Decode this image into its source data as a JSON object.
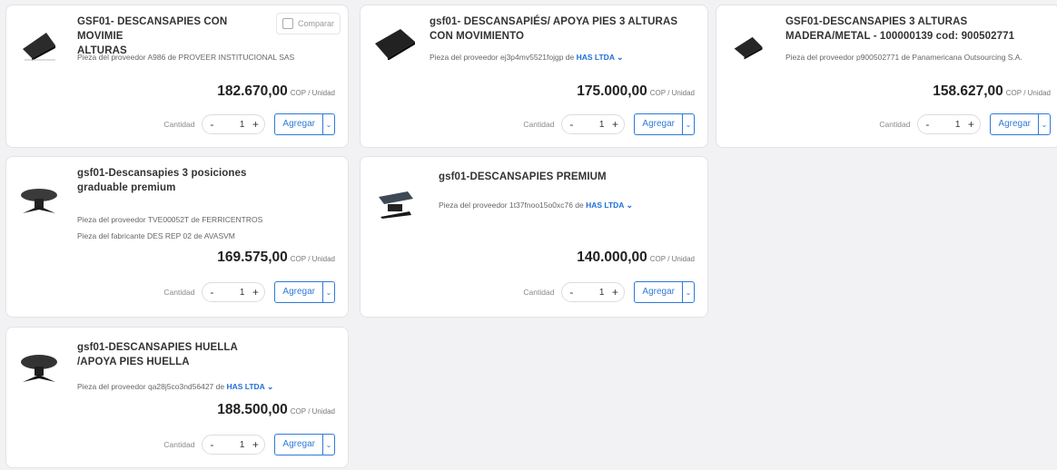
{
  "qty_label": "Cantidad",
  "add_label": "Agregar",
  "minus_symbol": "-",
  "plus_symbol": "+",
  "dropdown_symbol": "⌄",
  "compare_label": "Comparar",
  "unit_label": "COP / Unidad",
  "products": [
    {
      "title": "GSF01- DESCANSAPIES CON MOVIMIE",
      "title2": "ALTURAS",
      "meta1": "Pieza del proveedor A986 de PROVEER INSTITUCIONAL SAS",
      "price": "182.670,00",
      "qty": "1",
      "icon": "footrest-wedge-icon"
    },
    {
      "title": "gsf01- DESCANSAPIÉS/ APOYA PIES 3 ALTURAS CON MOVIMIENTO",
      "meta1_prefix": "Pieza del proveedor ej3p4mv5521fojgp de ",
      "vendor": "HAS LTDA",
      "price": "175.000,00",
      "qty": "1",
      "icon": "footrest-textured-icon"
    },
    {
      "title": "GSF01-DESCANSAPIES 3 ALTURAS MADERA/METAL - 100000139 cod: 900502771",
      "meta1": "Pieza del proveedor p900502771 de Panamericana Outsourcing S.A.",
      "price": "158.627,00",
      "qty": "1",
      "icon": "footrest-wood-icon"
    },
    {
      "title": "gsf01-Descansapies 3 posiciones graduable premium",
      "meta1": "Pieza del proveedor TVE00052T de FERRICENTROS",
      "meta2": "Pieza del fabricante DES REP 02 de AVASVM",
      "price": "169.575,00",
      "qty": "1",
      "icon": "footrest-premium-icon"
    },
    {
      "title": "gsf01-DESCANSAPIES PREMIUM",
      "meta1_prefix": "Pieza del proveedor 1t37fnoo15o0xc76 de ",
      "vendor": "HAS LTDA",
      "price": "140.000,00",
      "qty": "1",
      "icon": "footrest-adjustable-icon"
    },
    {
      "title": "gsf01-DESCANSAPIES HUELLA /APOYA PIES HUELLA",
      "meta1_prefix": "Pieza del proveedor qa28j5co3nd56427 de ",
      "vendor": "HAS LTDA",
      "price": "188.500,00",
      "qty": "1",
      "icon": "footrest-huella-icon"
    }
  ]
}
